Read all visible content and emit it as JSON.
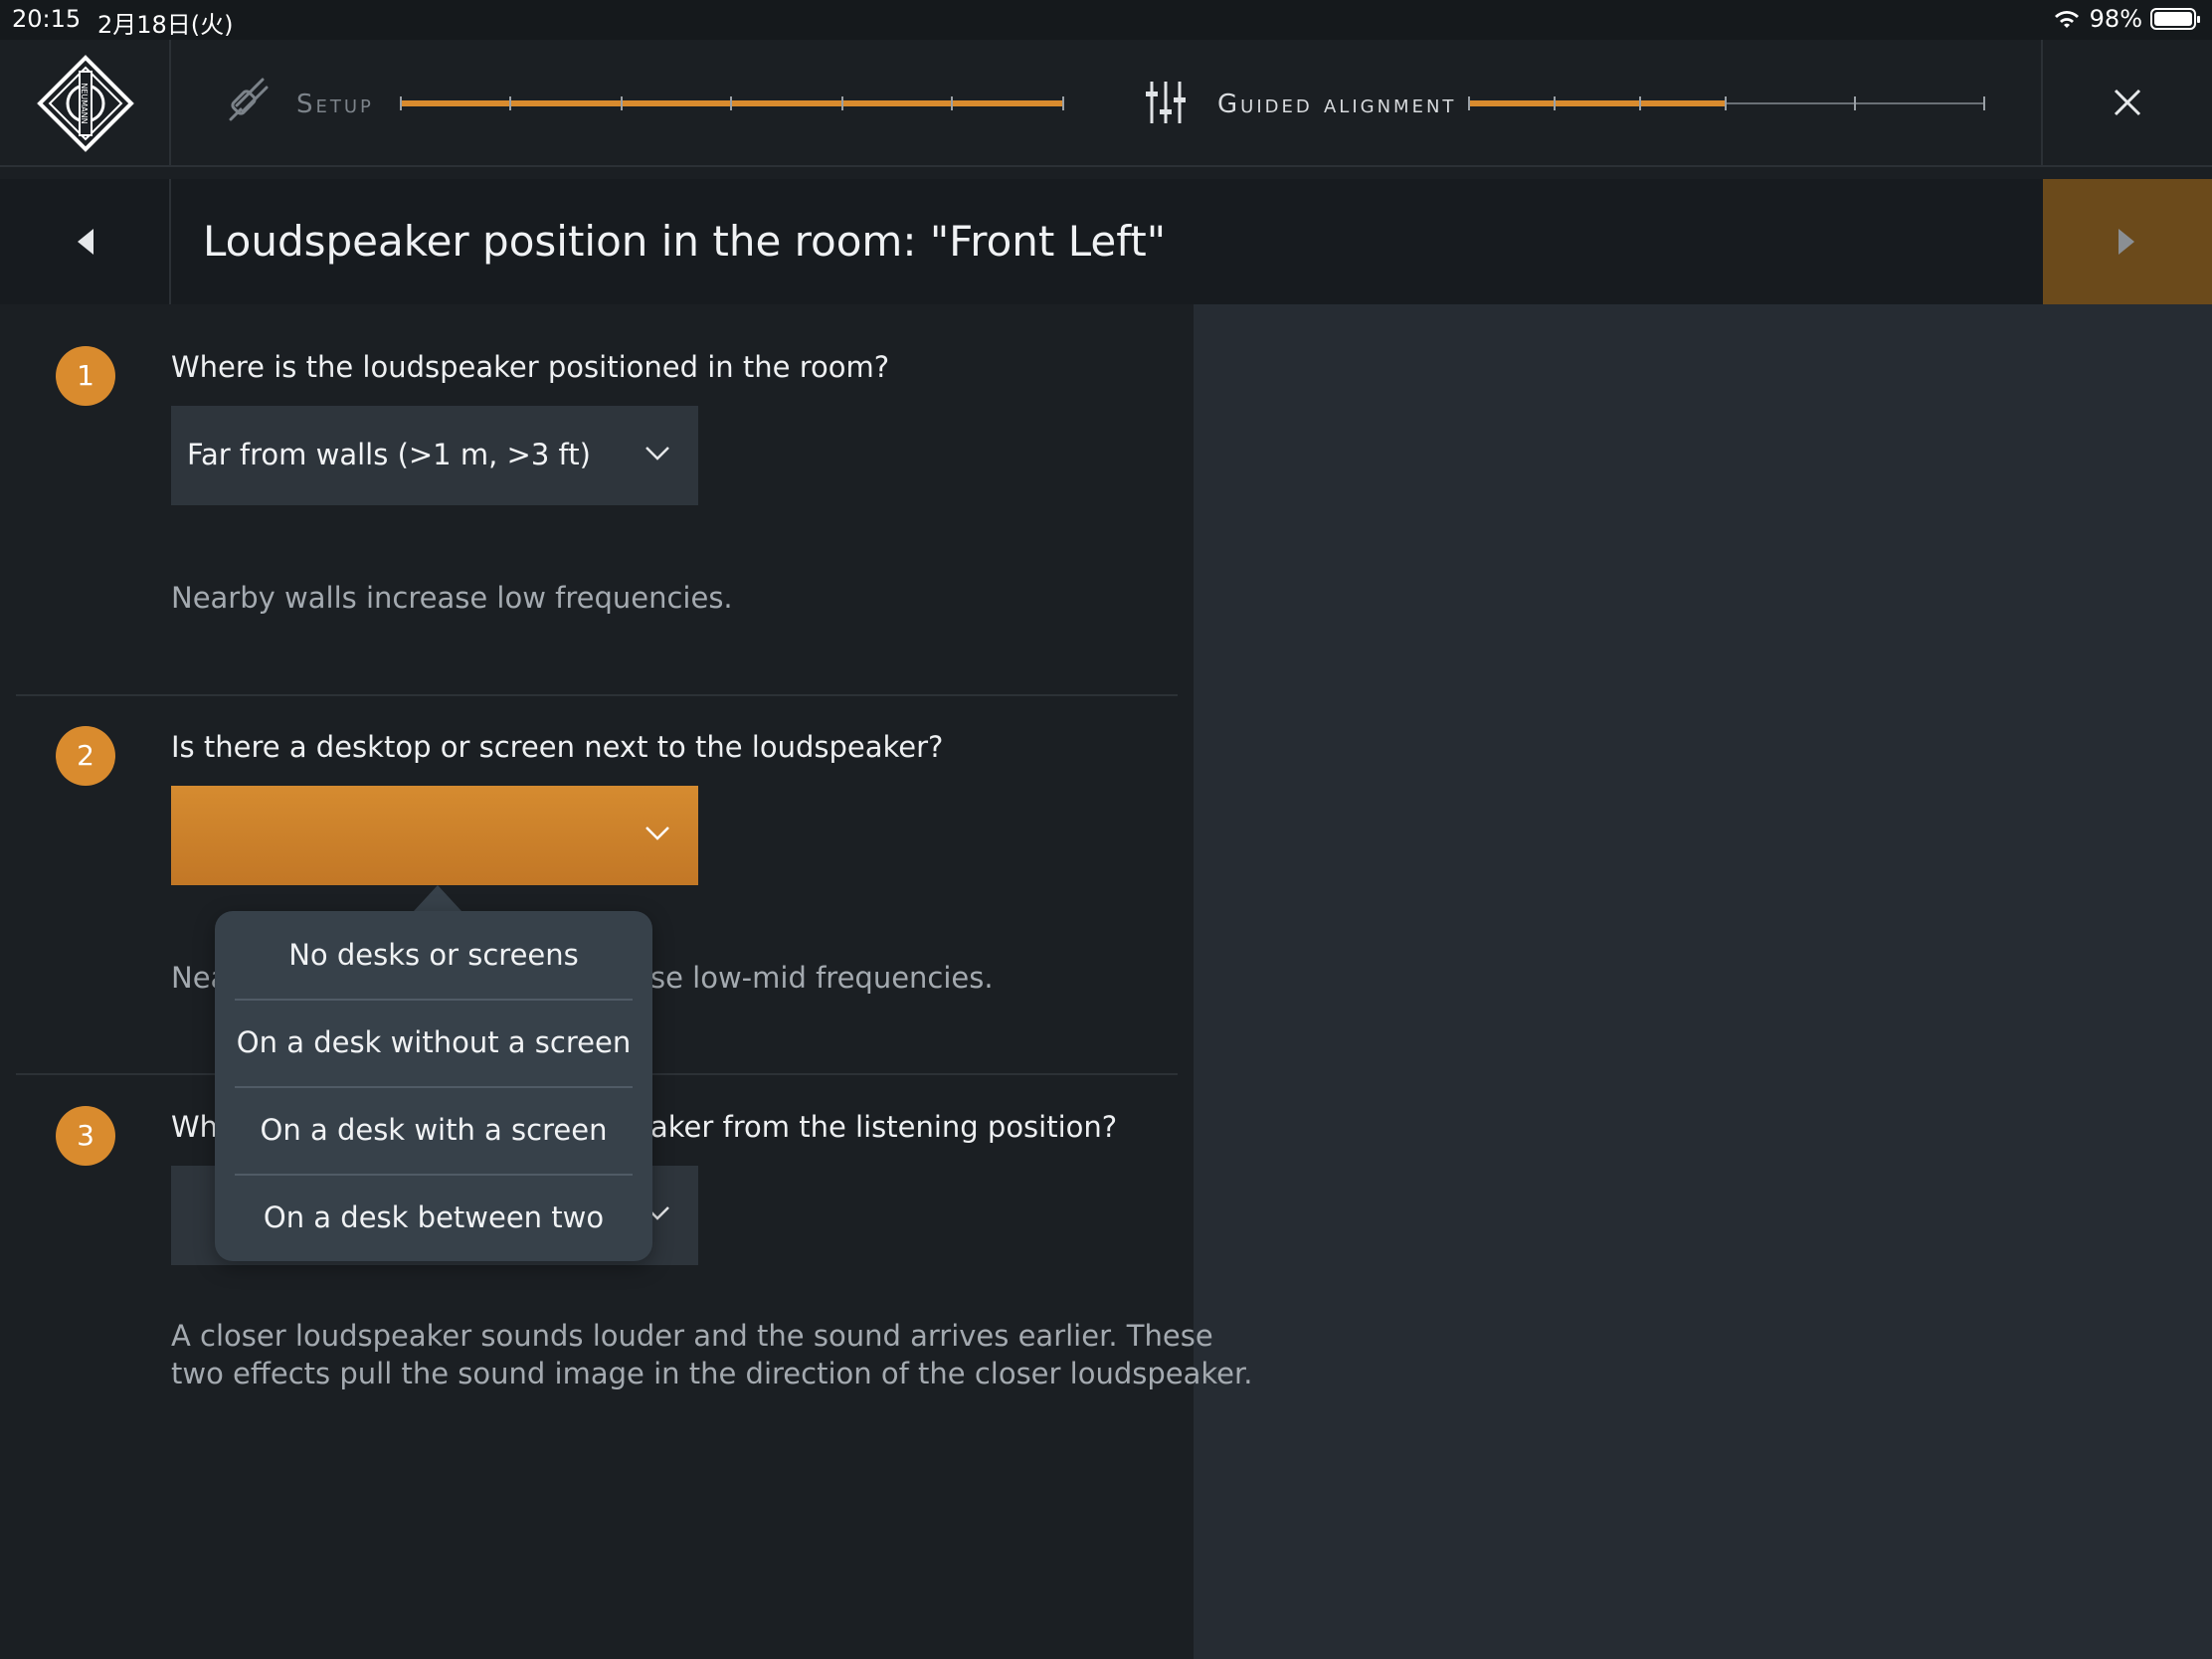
{
  "status_bar": {
    "time": "20:15",
    "date": "2月18日(火)",
    "battery": "98%"
  },
  "header": {
    "logo_text": "NEUMANN",
    "setup_label": "Setup",
    "setup_progress": 1.0,
    "alignment_label": "Guided alignment",
    "alignment_progress": 0.5
  },
  "title_bar": {
    "title": "Loudspeaker position in the room:  \"Front Left\""
  },
  "questions": [
    {
      "number": "1",
      "question": "Where is the loudspeaker positioned in the room?",
      "selected": "Far from walls (>1 m, >3 ft)",
      "hint": "Nearby walls increase low frequencies."
    },
    {
      "number": "2",
      "question": "Is there a desktop or screen next to the loudspeaker?",
      "selected": "",
      "hint_left": "Nea",
      "hint_right": "se low-mid frequencies."
    },
    {
      "number": "3",
      "question_left": "Wh",
      "question_right": "aker from the listening position?",
      "hint_line1": "A closer loudspeaker sounds louder and the sound arrives earlier. These",
      "hint_line2": "two effects pull the sound image in the direction of the closer loudspeaker."
    }
  ],
  "dropdown": {
    "options": [
      "No desks or screens",
      "On a desk without a screen",
      "On a desk with a screen",
      "On a desk between two screens"
    ]
  },
  "colors": {
    "accent": "#d98b2e",
    "background": "#1b1f23",
    "panel": "#262c33"
  }
}
